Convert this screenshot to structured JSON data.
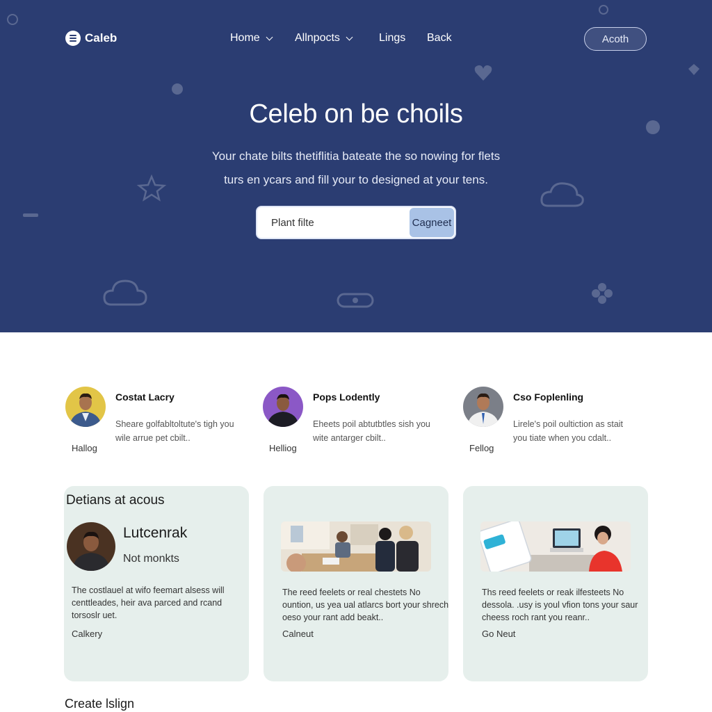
{
  "nav": {
    "brand": "Caleb",
    "links": [
      {
        "label": "Home",
        "has_dropdown": true
      },
      {
        "label": "Allnpocts",
        "has_dropdown": true
      },
      {
        "label": "Lings",
        "has_dropdown": false
      },
      {
        "label": "Back",
        "has_dropdown": false
      }
    ],
    "cta_label": "Acoth"
  },
  "hero": {
    "title": "Celeb on be choils",
    "subtitle_line1": "Your chate bilts thetiflitia bateate the so nowing for flets",
    "subtitle_line2": "turs en ycars and fill your to designed at your tens.",
    "search_placeholder": "Plant filte",
    "search_button": "Cagneet",
    "background_color": "#2b3d72"
  },
  "profiles": [
    {
      "name": "Costat Lacry",
      "desc": "Sheare golfabltoltute's tigh you wile arrue pet cbilt..",
      "tag": "Hallog",
      "avatar_bg": "#e2c547",
      "shirt": "#3c5a8c"
    },
    {
      "name": "Pops Lodently",
      "desc": "Eheets poil abtutbtles sish you wite antarger cbilt..",
      "tag": "Helliog",
      "avatar_bg": "#8b58c6",
      "shirt": "#1c1c24"
    },
    {
      "name": "Cso Foplenling",
      "desc": "Lirele's poil oultiction as stait you tiate when you cdalt..",
      "tag": "Fellog",
      "avatar_bg": "#7b7f88",
      "shirt": "#f0f0f0"
    }
  ],
  "cards": [
    {
      "title": "Detians at acous",
      "person_name": "Lutcenrak",
      "person_sub": "Not monkts",
      "desc": "The costlauel at wifo feemart alsess will centtleades, heir ava parced and rcand torsoslr uet.",
      "link": "Calkery"
    },
    {
      "desc": "The reed feelets or real chestets No ountion, us yea ual atlarcs bort your shrech oeso your rant add beakt..",
      "link": "Calneut"
    },
    {
      "desc": "Ths reed feelets or reak ilfesteets No dessola. .usy is youl vfion tons your saur cheess roch rant you reanr..",
      "link": "Go Neut"
    }
  ],
  "section_heading": "Create lslign"
}
